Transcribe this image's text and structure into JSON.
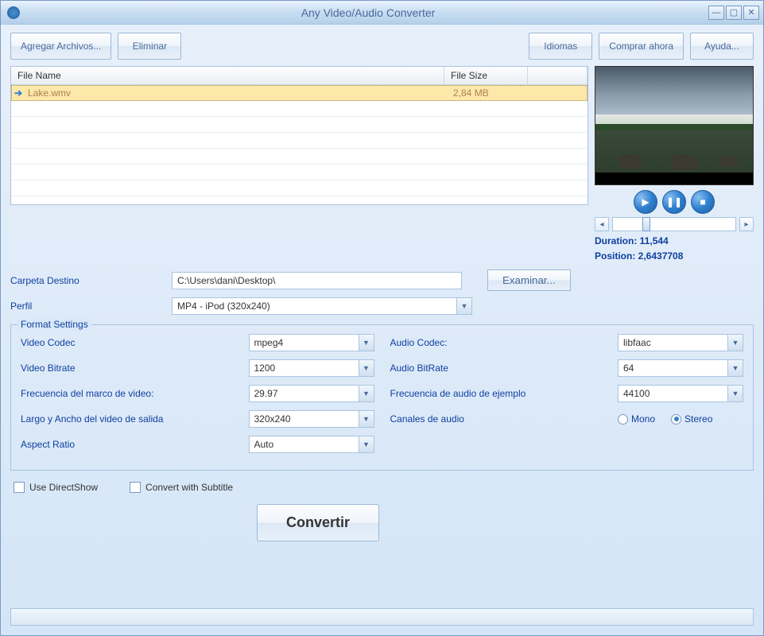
{
  "window": {
    "title": "Any Video/Audio Converter"
  },
  "toolbar": {
    "add_files": "Agregar Archivos...",
    "delete": "Eliminar",
    "languages": "Idiomas",
    "buy_now": "Comprar ahora",
    "help": "Ayuda..."
  },
  "table": {
    "col_name": "File Name",
    "col_size": "File Size",
    "rows": [
      {
        "name": "Lake.wmv",
        "size": "2,84 MB",
        "selected": true
      }
    ]
  },
  "preview": {
    "duration_label": "Duration:",
    "duration_value": "11,544",
    "position_label": "Position:",
    "position_value": "2,6437708"
  },
  "destination": {
    "folder_label": "Carpeta Destino",
    "folder_value": "C:\\Users\\dani\\Desktop\\",
    "browse": "Examinar...",
    "profile_label": "Perfil",
    "profile_value": "MP4 - iPod (320x240)"
  },
  "format": {
    "legend": "Format Settings",
    "video_codec_label": "Video Codec",
    "video_codec": "mpeg4",
    "video_bitrate_label": "Video Bitrate",
    "video_bitrate": "1200",
    "video_framerate_label": "Frecuencia del marco de video:",
    "video_framerate": "29.97",
    "video_size_label": "Largo y Ancho del video de salida",
    "video_size": "320x240",
    "aspect_label": "Aspect Ratio",
    "aspect": "Auto",
    "audio_codec_label": "Audio Codec:",
    "audio_codec": "libfaac",
    "audio_bitrate_label": "Audio BitRate",
    "audio_bitrate": "64",
    "audio_freq_label": "Frecuencia de audio de ejemplo",
    "audio_freq": "44100",
    "channels_label": "Canales de audio",
    "mono": "Mono",
    "stereo": "Stereo"
  },
  "options": {
    "directshow": "Use DirectShow",
    "subtitle": "Convert with Subtitle"
  },
  "convert": "Convertir"
}
